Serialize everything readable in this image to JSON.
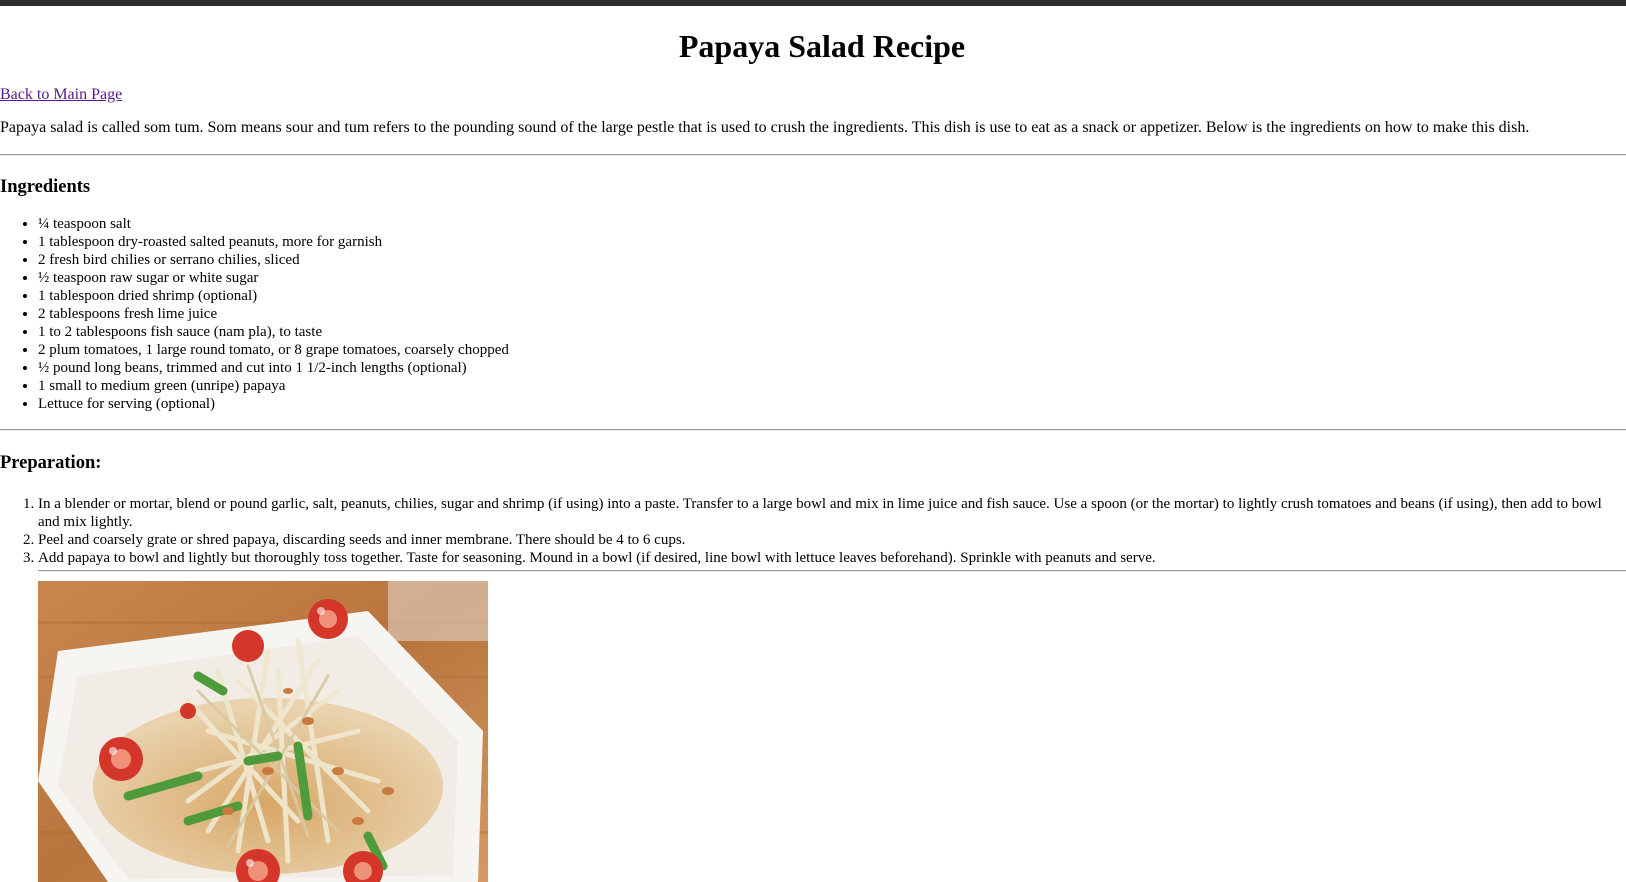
{
  "window": {
    "accent": "#2e2e30"
  },
  "page": {
    "title": "Papaya Salad Recipe",
    "back_link": "Back to Main Page",
    "intro": "Papaya salad is called som tum. Som means sour and tum refers to the pounding sound of the large pestle that is used to crush the ingredients. This dish is use to eat as a snack or appetizer. Below is the ingredients on how to make this dish."
  },
  "ingredients": {
    "heading": "Ingredients",
    "items": [
      "¼ teaspoon salt",
      "1 tablespoon dry-roasted salted peanuts, more for garnish",
      "2 fresh bird chilies or serrano chilies, sliced",
      "½ teaspoon raw sugar or white sugar",
      "1 tablespoon dried shrimp (optional)",
      "2 tablespoons fresh lime juice",
      "1 to 2 tablespoons fish sauce (nam pla), to taste",
      "2 plum tomatoes, 1 large round tomato, or 8 grape tomatoes, coarsely chopped",
      "½ pound long beans, trimmed and cut into 1 1/2-inch lengths (optional)",
      "1 small to medium green (unripe) papaya",
      "Lettuce for serving (optional)"
    ]
  },
  "preparation": {
    "heading": "Preparation:",
    "steps": [
      "In a blender or mortar, blend or pound garlic, salt, peanuts, chilies, sugar and shrimp (if using) into a paste. Transfer to a large bowl and mix in lime juice and fish sauce. Use a spoon (or the mortar) to lightly crush tomatoes and beans (if using), then add to bowl and mix lightly.",
      "Peel and coarsely grate or shred papaya, discarding seeds and inner membrane. There should be 4 to 6 cups.",
      "Add papaya to bowl and lightly but thoroughly toss together. Taste for seasoning. Mound in a bowl (if desired, line bowl with lettuce leaves beforehand). Sprinkle with peanuts and serve."
    ]
  },
  "colors": {
    "link_visited": "#551a8b",
    "rule": "#9a9a9a"
  },
  "image": {
    "icon": "papaya-salad-photo"
  }
}
